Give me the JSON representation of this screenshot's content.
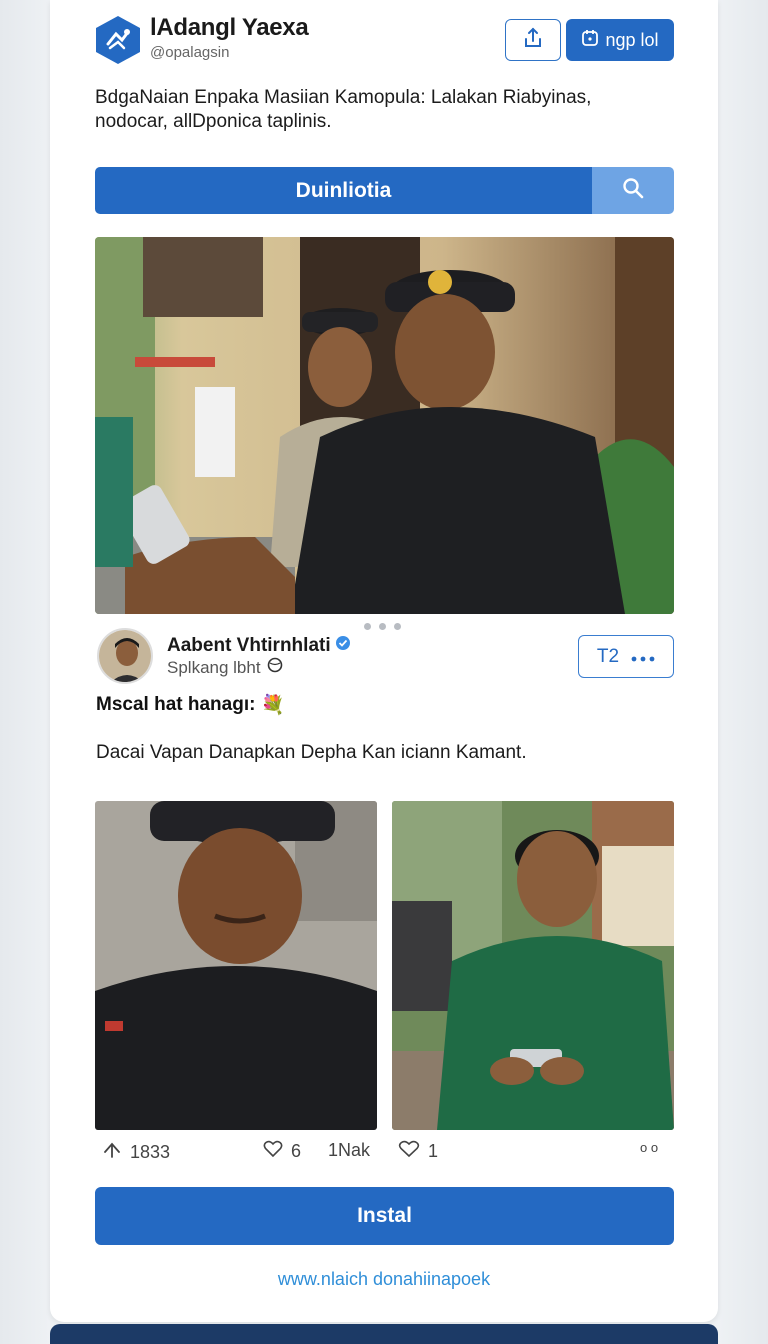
{
  "header": {
    "brand_name": "lAdangl Yaexa",
    "handle": "@opalagsin",
    "share_icon": "share-upload-icon",
    "primary_button_label": "ngp lol",
    "primary_button_icon": "sticker-icon"
  },
  "tagline": "BdgaNaian Enpaka Masiian Kamopula: Lalakan Riabyinas, nodocar, allDponica  taplinis.",
  "search": {
    "label": "Duinliotia",
    "icon": "search-icon"
  },
  "carousel": {
    "page_count": 3,
    "active_index": 0
  },
  "author": {
    "name": "Aabent Vhtirnhlati",
    "verified_icon": "verified-badge-icon",
    "subtitle": "Splkang lbht",
    "counter_value": "T2",
    "more_icon": "more-dots-icon"
  },
  "post": {
    "title": "Mscal hat hanagı:",
    "title_emoji": "💐",
    "body": "Dacai Vapan Danapkan Depha Kan iciann Kamant."
  },
  "stats": {
    "share_count": "1833",
    "like_count": "6",
    "views_label": "1Nak",
    "comment_count": "1",
    "more_label": "o o"
  },
  "install_label": "Instal",
  "footer_link": "www.nlaich donahiinapoek",
  "colors": {
    "primary": "#2469c2",
    "search_accent": "#6ea4e4",
    "link": "#2f8ed8",
    "footer_bar": "#1c3a66"
  }
}
